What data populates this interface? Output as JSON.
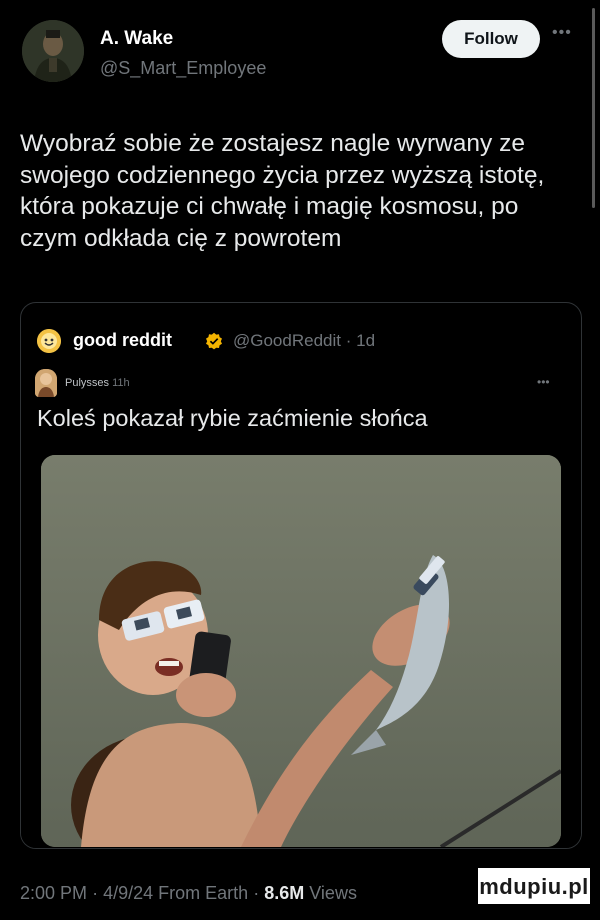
{
  "author": {
    "name": "A. Wake",
    "handle": "@S_Mart_Employee"
  },
  "follow_label": "Follow",
  "more_icon": "more-horizontal-icon",
  "tweet_text": "Wyobraź sobie że zostajesz nagle wyrwany ze swojego codziennego życia przez wyższą istotę, która pokazuje ci chwałę i magię kosmosu, po czym odkłada cię z powrotem",
  "quote": {
    "name": "good reddit",
    "verified_icon": "verified-badge-icon",
    "handle": "@GoodReddit",
    "separator": "·",
    "time": "1d",
    "embedded": {
      "name": "Pulysses",
      "time": "11h",
      "text": "Koleś pokazał rybie zaćmienie słońca"
    }
  },
  "meta": {
    "time": "2:00 PM",
    "date": "4/9/24",
    "source": "From Earth",
    "views_count": "8.6M",
    "views_label": "Views",
    "separator": "·"
  },
  "watermark": "mdupiu.pl",
  "colors": {
    "background": "#000000",
    "text": "#e7e9ea",
    "secondary": "#71767b",
    "verified": "#f4b400"
  }
}
